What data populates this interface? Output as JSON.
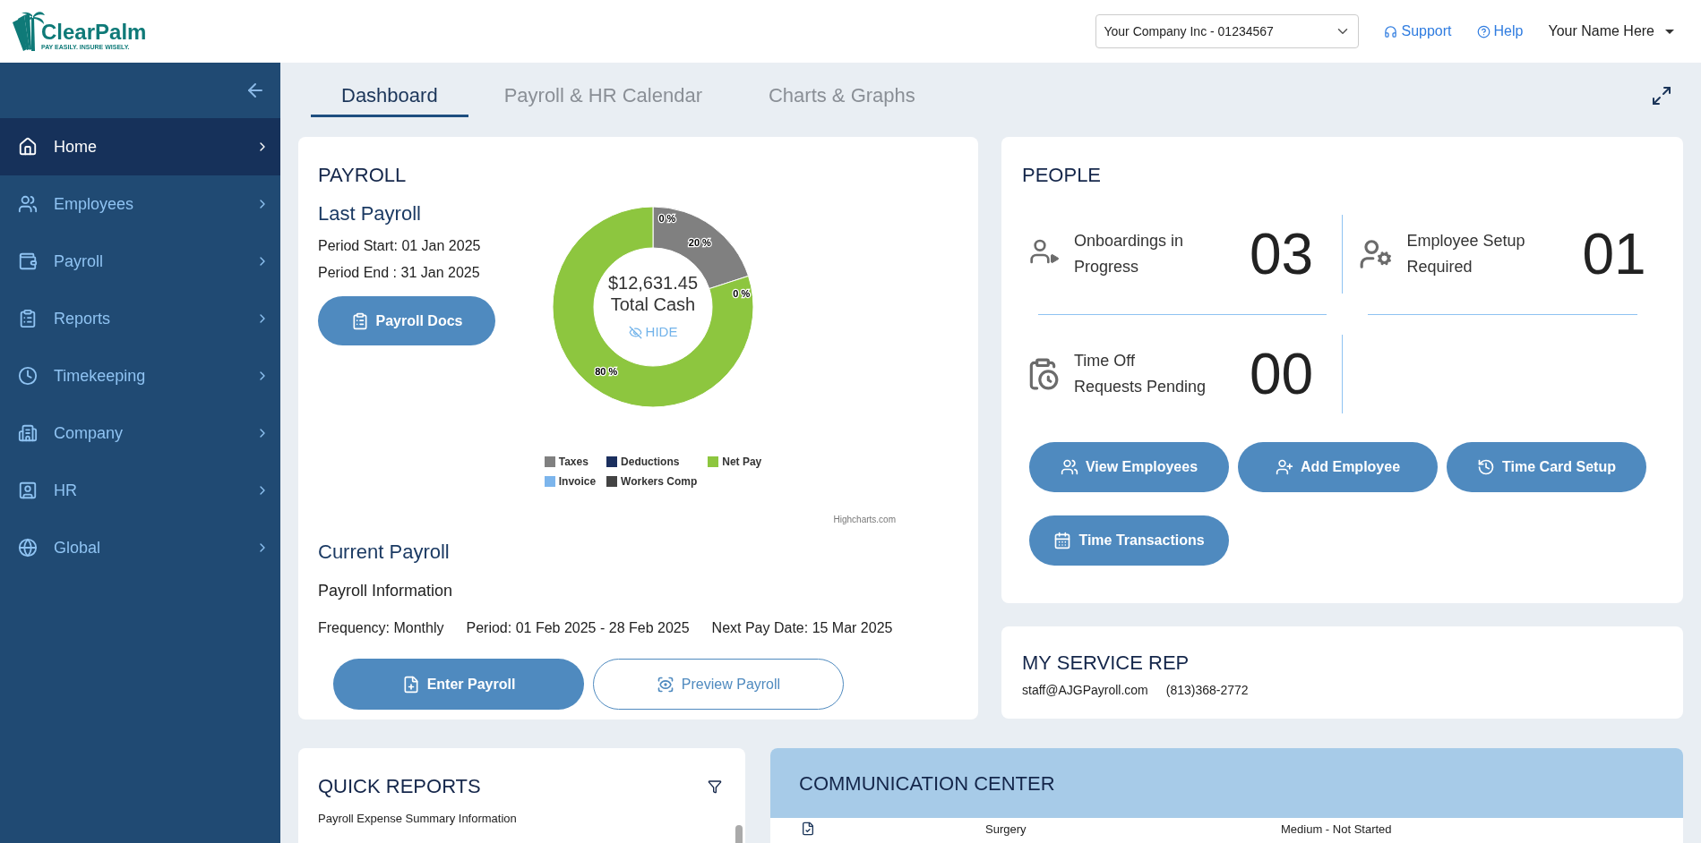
{
  "header": {
    "logo": {
      "name": "ClearPalm",
      "tagline": "PAY EASILY. INSURE WISELY."
    },
    "company_select": {
      "value": "Your Company Inc - 01234567"
    },
    "links": [
      {
        "kind": "support",
        "label": "Support"
      },
      {
        "kind": "help",
        "label": "Help"
      }
    ],
    "user": {
      "name": "Your Name Here"
    }
  },
  "sidebar": {
    "items": [
      {
        "label": "Home",
        "selected": true
      },
      {
        "label": "Employees",
        "selected": false
      },
      {
        "label": "Payroll",
        "selected": false
      },
      {
        "label": "Reports",
        "selected": false
      },
      {
        "label": "Timekeeping",
        "selected": false
      },
      {
        "label": "Company",
        "selected": false
      },
      {
        "label": "HR",
        "selected": false
      },
      {
        "label": "Global",
        "selected": false
      }
    ]
  },
  "tabs": [
    {
      "label": "Dashboard",
      "selected": true
    },
    {
      "label": "Payroll & HR Calendar",
      "selected": false
    },
    {
      "label": "Charts & Graphs",
      "selected": false
    }
  ],
  "payroll": {
    "title": "PAYROLL",
    "last_payroll": {
      "heading": "Last Payroll",
      "period_start": "Period Start: 01 Jan 2025",
      "period_end": "Period End : 31 Jan 2025",
      "button": "Payroll Docs"
    },
    "chart": {
      "center_amount": "$12,631.45",
      "hide_link": "HIDE",
      "credit": "Highcharts.com",
      "chart_data": {
        "type": "donut",
        "categories": [
          "Taxes",
          "Deductions",
          "Net Pay",
          "Invoice",
          "Workers Comp"
        ],
        "series": [
          {
            "name": "Total Cash",
            "values": [
              20,
              0,
              80,
              0,
              0
            ]
          }
        ],
        "legend": "bottom",
        "value_labels": [
          "20 %",
          "0 %",
          "80 %",
          null,
          "0 %"
        ]
      }
    },
    "current_payroll": {
      "heading": "Current Payroll",
      "subheading": "Payroll Information",
      "frequency": "Frequency: Monthly",
      "period": "Period: 01 Feb 2025 - 28 Feb 2025",
      "next_pay_date": "Next Pay Date: 15 Mar 2025"
    },
    "buttons": [
      {
        "kind": "primary",
        "label": "Enter Payroll"
      },
      {
        "kind": "outline",
        "label": "Preview Payroll"
      }
    ]
  },
  "people": {
    "title": "PEOPLE",
    "stats": [
      {
        "label": "Onboardings in\nProgress",
        "value": "03"
      },
      {
        "label": "Employee Setup\nRequired",
        "value": "01"
      },
      {
        "label": "Time Off\nRequests Pending",
        "value": "00"
      }
    ],
    "buttons": [
      "View Employees",
      "Add Employee",
      "Time Card Setup",
      "Time Transactions"
    ]
  },
  "service_rep": {
    "title": "MY SERVICE REP",
    "email": "staff@AJGPayroll.com",
    "phone": "(813)368-2772"
  },
  "quick_reports": {
    "title": "QUICK REPORTS",
    "items": [
      "Payroll Expense Summary Information"
    ]
  },
  "communication_center": {
    "title": "COMMUNICATION CENTER",
    "rows": [
      {
        "column_2": "Surgery",
        "column_3": "Medium - Not Started"
      }
    ]
  }
}
